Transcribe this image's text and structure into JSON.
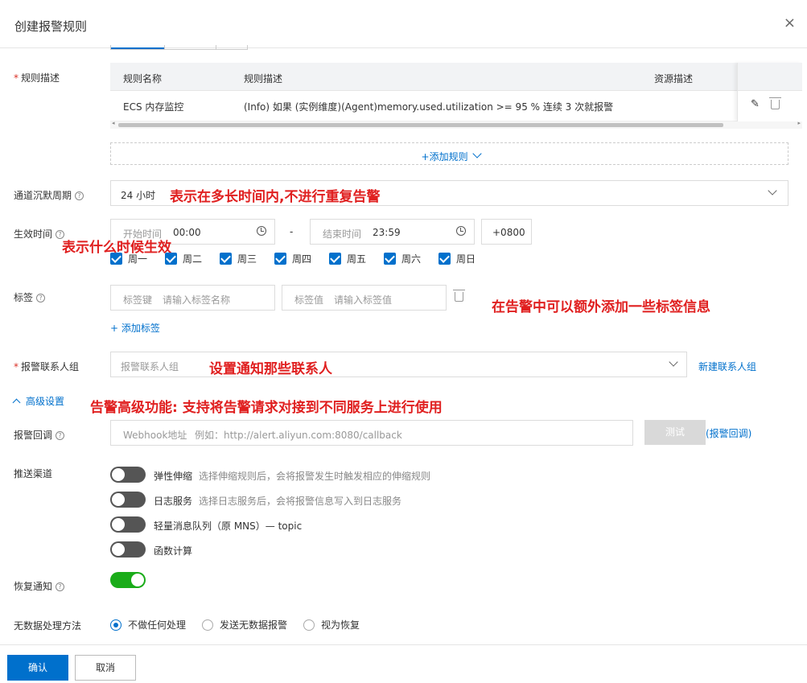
{
  "dialog": {
    "title": "创建报警规则",
    "close_icon": "×"
  },
  "rules": {
    "label": "规则描述",
    "columns": [
      "规则名称",
      "规则描述",
      "资源描述"
    ],
    "row": {
      "name": "ECS 内存监控",
      "desc": "(Info) 如果 (实例维度)(Agent)memory.used.utilization >= 95 % 连续 3 次就报警"
    },
    "add_label": "+添加规则"
  },
  "silence": {
    "label": "通道沉默周期",
    "value": "24 小时",
    "annotation": "表示在多长时间内,不进行重复告警"
  },
  "effective": {
    "label": "生效时间",
    "start_prefix": "开始时间",
    "start_value": "00:00",
    "end_prefix": "结束时间",
    "end_value": "23:59",
    "separator": "-",
    "timezone": "+0800",
    "annotation": "表示什么时候生效",
    "days": [
      "周一",
      "周二",
      "周三",
      "周四",
      "周五",
      "周六",
      "周日"
    ]
  },
  "tags": {
    "label": "标签",
    "key_prefix": "标签键",
    "key_placeholder": "请输入标签名称",
    "value_prefix": "标签值",
    "value_placeholder": "请输入标签值",
    "add_label": "+ 添加标签",
    "annotation": "在告警中可以额外添加一些标签信息"
  },
  "contacts": {
    "label": "报警联系人组",
    "placeholder": "报警联系人组",
    "annotation": "设置通知那些联系人",
    "new_link": "新建联系人组"
  },
  "advanced": {
    "label": "高级设置",
    "annotation": "告警高级功能: 支持将告警请求对接到不同服务上进行使用"
  },
  "callback": {
    "label": "报警回调",
    "prefix": "Webhook地址",
    "placeholder": "例如：http://alert.aliyun.com:8080/callback",
    "test_button": "测试",
    "link": "(报警回调)"
  },
  "channels": {
    "label": "推送渠道",
    "items": [
      {
        "name": "弹性伸缩",
        "desc": "选择伸缩规则后，会将报警发生时触发相应的伸缩规则"
      },
      {
        "name": "日志服务",
        "desc": "选择日志服务后，会将报警信息写入到日志服务"
      },
      {
        "name": "轻量消息队列（原 MNS）— topic",
        "desc": ""
      },
      {
        "name": "函数计算",
        "desc": ""
      }
    ]
  },
  "recovery": {
    "label": "恢复通知",
    "enabled": true
  },
  "nodata": {
    "label": "无数据处理方法",
    "options": [
      "不做任何处理",
      "发送无数据报警",
      "视为恢复"
    ],
    "selected": 0
  },
  "footer": {
    "confirm": "确认",
    "cancel": "取消"
  }
}
